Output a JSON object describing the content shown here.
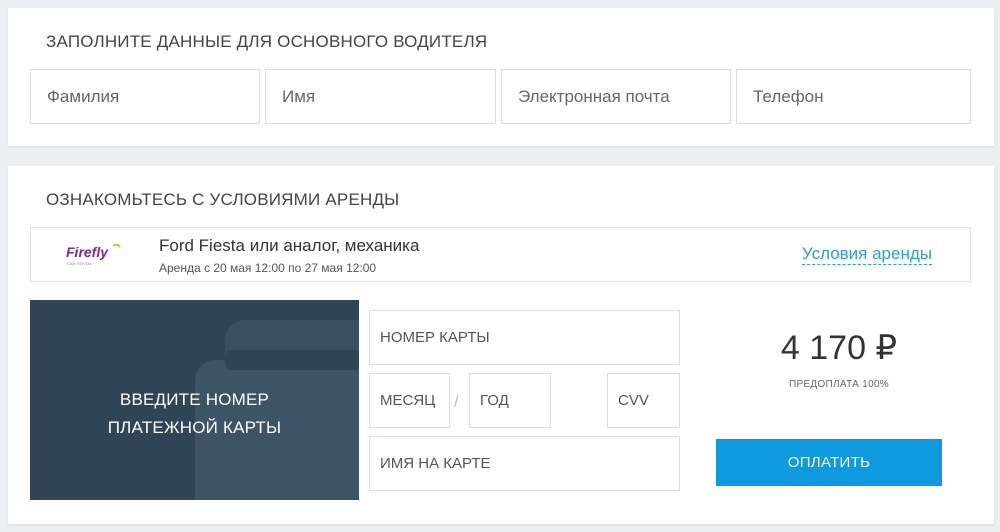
{
  "driver": {
    "title": "ЗАПОЛНИТЕ ДАННЫЕ ДЛЯ ОСНОВНОГО ВОДИТЕЛЯ",
    "fields": {
      "surname_placeholder": "Фамилия",
      "name_placeholder": "Имя",
      "email_placeholder": "Электронная почта",
      "phone_placeholder": "Телефон"
    }
  },
  "terms": {
    "title": "ОЗНАКОМЬТЕСЬ С УСЛОВИЯМИ АРЕНДЫ",
    "offer": {
      "logo_text": "Firefly",
      "logo_sub": "CAR RENTAL",
      "car_name": "Ford Fiesta или аналог, механика",
      "dates": "Аренда с 20 мая 12:00 по 27 мая 12:00",
      "terms_link": "Условия аренды"
    },
    "card_panel": {
      "line1": "ВВЕДИТЕ НОМЕР",
      "line2": "ПЛАТЕЖНОЙ КАРТЫ"
    },
    "payment": {
      "card_number_placeholder": "НОМЕР КАРТЫ",
      "month_placeholder": "МЕСЯЦ",
      "separator": "/",
      "year_placeholder": "ГОД",
      "cvv_placeholder": "CVV",
      "cardholder_placeholder": "ИМЯ НА КАРТЕ",
      "price": "4 170 ₽",
      "prepay_note": "ПРЕДОПЛАТА 100%",
      "pay_button": "ОПЛАТИТЬ"
    }
  },
  "colors": {
    "accent": "#0f9ae0",
    "link": "#2a9fd6",
    "card_panel": "#2f4456",
    "logo_purple": "#7a2b8f",
    "page_bg": "#eceff1"
  }
}
